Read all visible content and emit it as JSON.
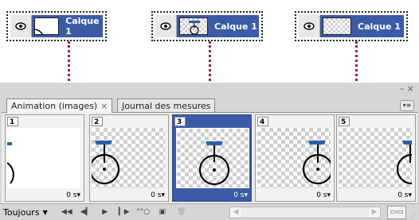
{
  "layers": [
    {
      "name": "Calque 1",
      "thumb": "white-circle-fragment"
    },
    {
      "name": "Calque 1",
      "thumb": "unicycle-small"
    },
    {
      "name": "Calque 1",
      "thumb": "checker-empty"
    }
  ],
  "panel": {
    "tabs": [
      {
        "label": "Animation (images)",
        "close": "×",
        "active": true
      },
      {
        "label": "Journal des mesures",
        "active": false
      }
    ],
    "window_controls": "– ×",
    "menu_icon": "menu-icon"
  },
  "frames": [
    {
      "number": "1",
      "delay": "0 s",
      "background": "white",
      "selected": false
    },
    {
      "number": "2",
      "delay": "0 s",
      "background": "checker",
      "selected": false
    },
    {
      "number": "3",
      "delay": "0 s",
      "background": "checker",
      "selected": true
    },
    {
      "number": "4",
      "delay": "0 s",
      "background": "checker",
      "selected": false
    },
    {
      "number": "5",
      "delay": "0 s",
      "background": "checker",
      "selected": false
    }
  ],
  "toolbar": {
    "loop_value": "Toujours",
    "buttons": [
      "first-frame-icon",
      "prev-frame-icon",
      "play-icon",
      "next-frame-icon",
      "tween-icon",
      "duplicate-frame-icon",
      "delete-frame-icon"
    ]
  },
  "colors": {
    "selection_blue": "#3b5ba7",
    "connector": "#9a1e4e"
  }
}
